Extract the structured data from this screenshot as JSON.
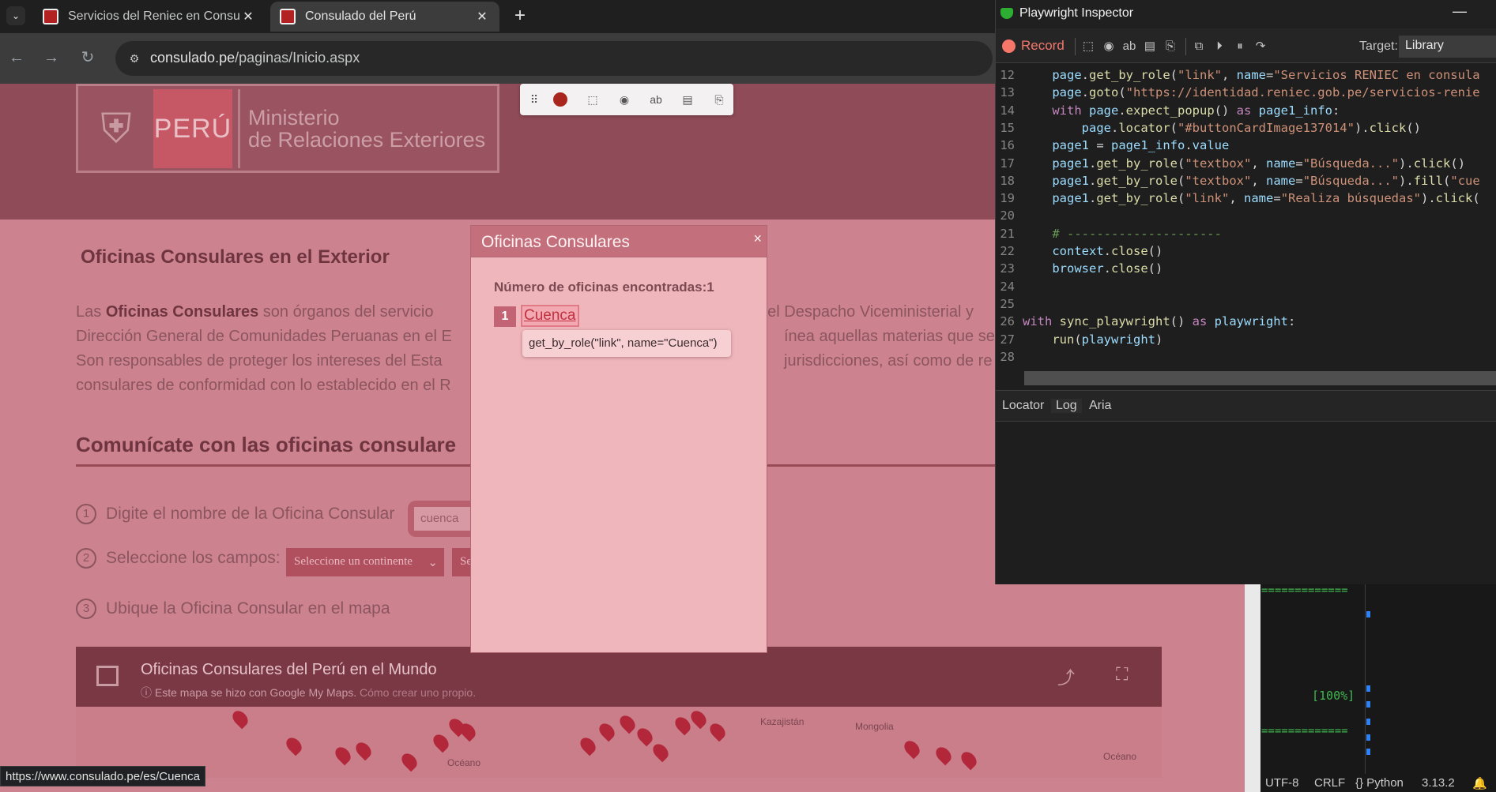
{
  "browser": {
    "tabs": [
      {
        "title": "Servicios del Reniec en Consula",
        "close": "✕"
      },
      {
        "title": "Consulado del Perú",
        "close": "✕"
      }
    ],
    "new_tab": "+",
    "dropdown": "⌄",
    "url_host": "consulado.pe",
    "url_path": "/paginas/Inicio.aspx",
    "status_url": "https://www.consulado.pe/es/Cuenca"
  },
  "page": {
    "logo_peru": "PERÚ",
    "logo_ministry_line1": "Ministerio",
    "logo_ministry_line2": "de Relaciones Exteriores",
    "heading": "Oficinas Consulares en el Exterior",
    "para": {
      "l1_a": "Las ",
      "l1_b": "Oficinas Consulares",
      "l1_c": " son órganos del servicio",
      "l1_d": "del Despacho Viceministerial y",
      "l2_a": "Dirección General de Comunidades Peruanas en el E",
      "l2_b": "ínea aquellas materias que se",
      "l3_a": "Son responsables de proteger los intereses del Esta",
      "l3_b": "jurisdicciones, así como de re",
      "l4": "consulares de conformidad con lo establecido en el R"
    },
    "section_title": "Comunícate con las oficinas consulare",
    "step1": {
      "num": "1",
      "label": "Digite el nombre de la Oficina Consular",
      "value": "cuenca"
    },
    "step2": {
      "num": "2",
      "label": "Seleccione los campos:",
      "continent": "Seleccione un continente",
      "second": "Se"
    },
    "step3": {
      "num": "3",
      "label": "Ubique la Oficina Consular en el mapa"
    },
    "map": {
      "title": "Oficinas Consulares del Perú en el Mundo",
      "sub_a": "Este mapa se hizo con Google My Maps.",
      "sub_b": "Cómo crear uno propio.",
      "labels": [
        "Kazajistán",
        "Mongolia",
        "Océano",
        "Océano"
      ]
    }
  },
  "modal": {
    "title": "Oficinas Consulares",
    "close": "×",
    "count": "Número de oficinas encontradas:1",
    "result_num": "1",
    "result_link": "Cuenca",
    "tooltip": "get_by_role(\"link\", name=\"Cuenca\")"
  },
  "inspector": {
    "title": "Playwright Inspector",
    "record": "Record",
    "target_label": "Target:",
    "target_value": "Library",
    "code_lines": [
      {
        "n": "12",
        "indent": "    ",
        "parts": [
          [
            "v",
            "page"
          ],
          [
            "",
            "."
          ],
          [
            "fn",
            "get_by_role"
          ],
          [
            "",
            "("
          ],
          [
            "s",
            "\"link\""
          ],
          [
            "",
            " , "
          ],
          [
            "v",
            "name"
          ],
          [
            "",
            "="
          ],
          [
            "s",
            "\"Servicios RENIEC en consula"
          ]
        ]
      },
      {
        "n": "13",
        "indent": "    ",
        "parts": [
          [
            "v",
            "page"
          ],
          [
            "",
            "."
          ],
          [
            "fn",
            "goto"
          ],
          [
            "",
            "("
          ],
          [
            "s",
            "\"https://identidad.reniec.gob.pe/servicios-renie"
          ]
        ]
      },
      {
        "n": "14",
        "indent": "    ",
        "parts": [
          [
            "k",
            "with "
          ],
          [
            "v",
            "page"
          ],
          [
            "",
            "."
          ],
          [
            "fn",
            "expect_popup"
          ],
          [
            "",
            "() "
          ],
          [
            "k",
            "as "
          ],
          [
            "v",
            "page1_info"
          ],
          [
            "",
            ":"
          ]
        ]
      },
      {
        "n": "15",
        "indent": "        ",
        "parts": [
          [
            "v",
            "page"
          ],
          [
            "",
            "."
          ],
          [
            "fn",
            "locator"
          ],
          [
            "",
            "("
          ],
          [
            "s",
            "\"#buttonCardImage137014\""
          ],
          [
            "",
            ")."
          ],
          [
            "fn",
            "click"
          ],
          [
            "",
            "()"
          ]
        ]
      },
      {
        "n": "16",
        "indent": "    ",
        "parts": [
          [
            "v",
            "page1"
          ],
          [
            "",
            " = "
          ],
          [
            "v",
            "page1_info"
          ],
          [
            "",
            "."
          ],
          [
            "v",
            "value"
          ]
        ]
      },
      {
        "n": "17",
        "indent": "    ",
        "parts": [
          [
            "v",
            "page1"
          ],
          [
            "",
            "."
          ],
          [
            "fn",
            "get_by_role"
          ],
          [
            "",
            "("
          ],
          [
            "s",
            "\"textbox\""
          ],
          [
            "",
            ", "
          ],
          [
            "v",
            "name"
          ],
          [
            "",
            "="
          ],
          [
            "s",
            "\"Búsqueda...\""
          ],
          [
            "",
            ")."
          ],
          [
            "fn",
            "click"
          ],
          [
            "",
            "()"
          ]
        ]
      },
      {
        "n": "18",
        "indent": "    ",
        "parts": [
          [
            "v",
            "page1"
          ],
          [
            "",
            "."
          ],
          [
            "fn",
            "get_by_role"
          ],
          [
            "",
            "("
          ],
          [
            "s",
            "\"textbox\""
          ],
          [
            "",
            ", "
          ],
          [
            "v",
            "name"
          ],
          [
            "",
            "="
          ],
          [
            "s",
            "\"Búsqueda...\""
          ],
          [
            "",
            ")."
          ],
          [
            "fn",
            "fill"
          ],
          [
            "",
            "("
          ],
          [
            "s",
            "\"cue"
          ]
        ]
      },
      {
        "n": "19",
        "indent": "    ",
        "parts": [
          [
            "v",
            "page1"
          ],
          [
            "",
            "."
          ],
          [
            "fn",
            "get_by_role"
          ],
          [
            "",
            "("
          ],
          [
            "s",
            "\"link\""
          ],
          [
            "",
            ", "
          ],
          [
            "v",
            "name"
          ],
          [
            "",
            "="
          ],
          [
            "s",
            "\"Realiza búsquedas\""
          ],
          [
            "",
            ")."
          ],
          [
            "fn",
            "click"
          ],
          [
            "",
            "("
          ]
        ]
      },
      {
        "n": "20",
        "indent": "",
        "parts": []
      },
      {
        "n": "21",
        "indent": "    ",
        "parts": [
          [
            "c",
            "# ---------------------"
          ]
        ]
      },
      {
        "n": "22",
        "indent": "    ",
        "parts": [
          [
            "v",
            "context"
          ],
          [
            "",
            "."
          ],
          [
            "fn",
            "close"
          ],
          [
            "",
            "()"
          ]
        ]
      },
      {
        "n": "23",
        "indent": "    ",
        "parts": [
          [
            "v",
            "browser"
          ],
          [
            "",
            "."
          ],
          [
            "fn",
            "close"
          ],
          [
            "",
            "()"
          ]
        ]
      },
      {
        "n": "24",
        "indent": "",
        "parts": []
      },
      {
        "n": "25",
        "indent": "",
        "parts": []
      },
      {
        "n": "26",
        "indent": "",
        "parts": [
          [
            "k",
            "with "
          ],
          [
            "fn",
            "sync_playwright"
          ],
          [
            "",
            "() "
          ],
          [
            "k",
            "as "
          ],
          [
            "v",
            "playwright"
          ],
          [
            "",
            ":"
          ]
        ]
      },
      {
        "n": "27",
        "indent": "    ",
        "parts": [
          [
            "fn",
            "run"
          ],
          [
            "",
            "("
          ],
          [
            "v",
            "playwright"
          ],
          [
            "",
            ")"
          ]
        ]
      },
      {
        "n": "28",
        "indent": "",
        "parts": []
      }
    ],
    "bottom_tabs": [
      "Locator",
      "Log",
      "Aria"
    ]
  },
  "terminal": {
    "rule1": "=============",
    "percent": "[100%]",
    "rule2": "=============",
    "status": {
      "encoding": "UTF-8",
      "eol": "CRLF",
      "lang": "{} Python",
      "version": "3.13.2"
    }
  }
}
